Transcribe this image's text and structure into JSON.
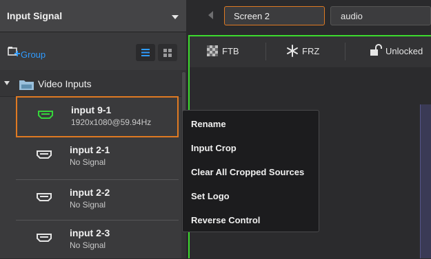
{
  "left_panel": {
    "title": "Input Signal",
    "group_label": "Group",
    "folder_label": "Video Inputs",
    "inputs": [
      {
        "name": "input 9-1",
        "status": "1920x1080@59.94Hz",
        "selected": true
      },
      {
        "name": "input 2-1",
        "status": "No Signal",
        "selected": false
      },
      {
        "name": "input 2-2",
        "status": "No Signal",
        "selected": false
      },
      {
        "name": "input 2-3",
        "status": "No Signal",
        "selected": false
      }
    ]
  },
  "top_bar": {
    "screen_tab": "Screen 2",
    "audio_tab": "audio"
  },
  "toolbar": {
    "ftb": "FTB",
    "frz": "FRZ",
    "lock": "Unlocked"
  },
  "context_menu": {
    "items": [
      "Rename",
      "Input Crop",
      "Clear All Cropped Sources",
      "Set Logo",
      "Reverse Control"
    ]
  },
  "colors": {
    "accent": "#e07a22",
    "link": "#2f9bff",
    "active_green": "#3ddc2e",
    "signal_icon_active": "#35d63a"
  },
  "icons": [
    "dropdown-caret-icon",
    "group-add-icon",
    "list-view-icon",
    "grid-view-icon",
    "folder-icon",
    "hdmi-icon",
    "back-arrow-icon",
    "ftb-icon",
    "freeze-icon",
    "unlock-icon"
  ]
}
